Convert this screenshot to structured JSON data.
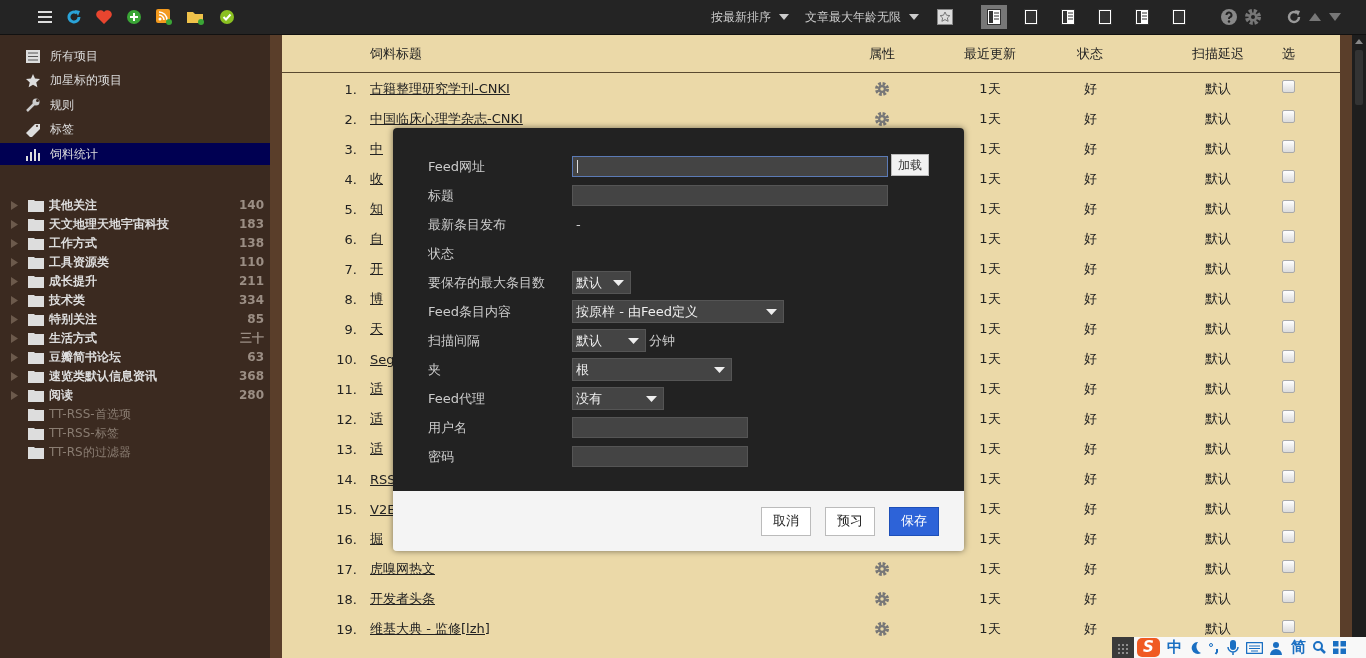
{
  "toolbar": {
    "sort": {
      "label": "按最新排序"
    },
    "age": {
      "label": "文章最大年龄无限"
    },
    "view_modes": [
      {
        "selected": true
      },
      {
        "selected": false
      },
      {
        "selected": false
      },
      {
        "selected": false
      },
      {
        "selected": false
      },
      {
        "selected": false
      }
    ]
  },
  "sidebar": {
    "specials": [
      {
        "kind": "all",
        "label": "所有项目",
        "selected": false
      },
      {
        "kind": "starred",
        "label": "加星标的项目",
        "selected": false
      },
      {
        "kind": "rules",
        "label": "规则",
        "selected": false
      },
      {
        "kind": "labels",
        "label": "标签",
        "selected": false
      },
      {
        "kind": "stats",
        "label": "饲料统计",
        "selected": true
      }
    ],
    "folders": [
      {
        "label": "其他关注",
        "count": "140",
        "has_children": true,
        "disabled": false
      },
      {
        "label": "天文地理天地宇宙科技",
        "count": "183",
        "has_children": true,
        "disabled": false
      },
      {
        "label": "工作方式",
        "count": "138",
        "has_children": true,
        "disabled": false
      },
      {
        "label": "工具资源类",
        "count": "110",
        "has_children": true,
        "disabled": false
      },
      {
        "label": "成长提升",
        "count": "211",
        "has_children": true,
        "disabled": false
      },
      {
        "label": "技术类",
        "count": "334",
        "has_children": true,
        "disabled": false
      },
      {
        "label": "特别关注",
        "count": "85",
        "has_children": true,
        "disabled": false
      },
      {
        "label": "生活方式",
        "count": "三十",
        "has_children": true,
        "disabled": false
      },
      {
        "label": "豆瓣简书论坛",
        "count": "63",
        "has_children": true,
        "disabled": false
      },
      {
        "label": "速览类默认信息资讯",
        "count": "368",
        "has_children": true,
        "disabled": false
      },
      {
        "label": "阅读",
        "count": "280",
        "has_children": true,
        "disabled": false
      },
      {
        "label": "TT-RSS-首选项",
        "has_children": false,
        "disabled": true
      },
      {
        "label": "TT-RSS-标签",
        "has_children": false,
        "disabled": true
      },
      {
        "label": "TT-RS的过滤器",
        "has_children": false,
        "disabled": true
      }
    ]
  },
  "table": {
    "columns": [
      "饲料标题",
      "属性",
      "最近更新",
      "状态",
      "扫描延迟",
      "选"
    ],
    "rows": [
      {
        "number": "1.",
        "title": "古籍整理研究学刊-CNKI",
        "settings_icon": true,
        "updated": "1天",
        "status": "好",
        "delay": "默认",
        "checked": false
      },
      {
        "number": "2.",
        "title": "中国临床心理学杂志-CNKI",
        "settings_icon": true,
        "updated": "1天",
        "status": "好",
        "delay": "默认",
        "checked": false
      },
      {
        "number": "3.",
        "title": "中",
        "updated": "1天",
        "status": "好",
        "delay": "默认",
        "checked": false
      },
      {
        "number": "4.",
        "title": "收",
        "updated": "1天",
        "status": "好",
        "delay": "默认",
        "checked": false
      },
      {
        "number": "5.",
        "title": "知",
        "updated": "1天",
        "status": "好",
        "delay": "默认",
        "checked": false
      },
      {
        "number": "6.",
        "title": "自",
        "updated": "1天",
        "status": "好",
        "delay": "默认",
        "checked": false
      },
      {
        "number": "7.",
        "title": "开",
        "updated": "1天",
        "status": "好",
        "delay": "默认",
        "checked": false
      },
      {
        "number": "8.",
        "title": "博",
        "updated": "1天",
        "status": "好",
        "delay": "默认",
        "checked": false
      },
      {
        "number": "9.",
        "title": "天",
        "updated": "1天",
        "status": "好",
        "delay": "默认",
        "checked": false
      },
      {
        "number": "10.",
        "title": "Seg",
        "updated": "1天",
        "status": "好",
        "delay": "默认",
        "checked": false
      },
      {
        "number": "11.",
        "title": "适",
        "updated": "1天",
        "status": "好",
        "delay": "默认",
        "checked": false
      },
      {
        "number": "12.",
        "title": "适",
        "updated": "1天",
        "status": "好",
        "delay": "默认",
        "checked": false
      },
      {
        "number": "13.",
        "title": "适",
        "updated": "1天",
        "status": "好",
        "delay": "默认",
        "checked": false
      },
      {
        "number": "14.",
        "title": "RSS",
        "updated": "1天",
        "status": "好",
        "delay": "默认",
        "checked": false
      },
      {
        "number": "15.",
        "title": "V2E",
        "updated": "1天",
        "status": "好",
        "delay": "默认",
        "checked": false
      },
      {
        "number": "16.",
        "title": "掘",
        "updated": "1天",
        "status": "好",
        "delay": "默认",
        "checked": false
      },
      {
        "number": "17.",
        "title": "虎嗅网热文",
        "settings_icon": true,
        "updated": "1天",
        "status": "好",
        "delay": "默认",
        "checked": false
      },
      {
        "number": "18.",
        "title": "开发者头条",
        "settings_icon": true,
        "updated": "1天",
        "status": "好",
        "delay": "默认",
        "checked": false
      },
      {
        "number": "19.",
        "title": "维基大典 - 监修[lzh]",
        "settings_icon": true,
        "updated": "1天",
        "status": "好",
        "delay": "默认",
        "checked": false
      }
    ]
  },
  "dialog": {
    "fields": [
      {
        "kind": "input",
        "label": "Feed网址",
        "focused": true,
        "button": "加载"
      },
      {
        "kind": "input",
        "label": "标题",
        "focused": false
      },
      {
        "kind": "text",
        "label": "最新条目发布",
        "value": "-"
      },
      {
        "kind": "text",
        "label": "状态"
      },
      {
        "kind": "select",
        "label": "要保存的最大条目数",
        "value": "默认"
      },
      {
        "kind": "select",
        "label": "Feed条目内容",
        "value": "按原样 - 由Feed定义"
      },
      {
        "kind": "select",
        "label": "扫描间隔",
        "value": "默认",
        "suffix": "分钟"
      },
      {
        "kind": "select",
        "label": "夹",
        "value": "根"
      },
      {
        "kind": "select",
        "label": "Feed代理",
        "value": "没有"
      },
      {
        "kind": "input",
        "label": "用户名",
        "focused": false
      },
      {
        "kind": "input",
        "label": "密码",
        "focused": false
      }
    ],
    "buttons": [
      {
        "label": "取消",
        "kind": "secondary"
      },
      {
        "label": "预习",
        "kind": "secondary"
      },
      {
        "label": "保存",
        "kind": "primary"
      }
    ]
  },
  "ime_bar": {
    "logo": "S",
    "mode": "中",
    "script": "简"
  }
}
